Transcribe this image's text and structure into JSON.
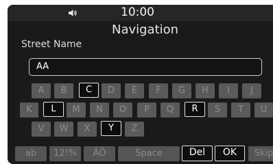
{
  "status_bar": {
    "volume_icon": "speaker-icon",
    "time": "10:00"
  },
  "header": {
    "title": "Navigation"
  },
  "field": {
    "label": "Street Name",
    "value": "AA"
  },
  "keyboard": {
    "row1": [
      "A",
      "B",
      "C",
      "D",
      "E",
      "F",
      "G",
      "H",
      "I",
      "J"
    ],
    "row2": [
      "K",
      "L",
      "M",
      "N",
      "O",
      "P",
      "Q",
      "R",
      "S",
      "T",
      "U"
    ],
    "row3": [
      "V",
      "W",
      "X",
      "Y",
      "Z"
    ],
    "enabled_keys": [
      "C",
      "L",
      "R",
      "Y"
    ],
    "function_keys": {
      "lowercase": "ab",
      "symbols": "12!%",
      "accents": "ÄÖ",
      "space": "Space",
      "delete": "Del",
      "ok": "OK",
      "skip": "Skip"
    }
  },
  "colors": {
    "screen_background": "#1a1a1a",
    "key_disabled": "#5a5a5a",
    "key_enabled_border": "#e6e6e6"
  }
}
